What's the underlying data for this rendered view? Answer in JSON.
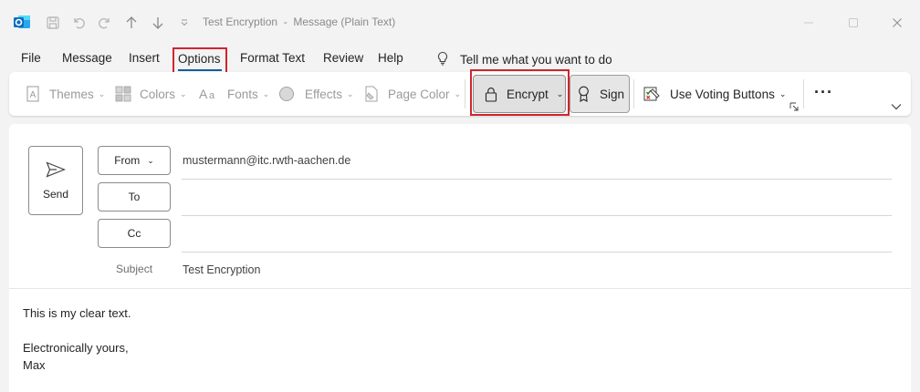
{
  "window": {
    "title": "Test Encryption",
    "title_sep": "-",
    "title_suffix": "Message (Plain Text)"
  },
  "menu": {
    "tabs": [
      "File",
      "Message",
      "Insert",
      "Options",
      "Format Text",
      "Review",
      "Help"
    ],
    "tell_me": "Tell me what you want to do"
  },
  "ribbon": {
    "themes": "Themes",
    "colors": "Colors",
    "fonts": "Fonts",
    "effects": "Effects",
    "page_color": "Page Color",
    "encrypt": "Encrypt",
    "sign": "Sign",
    "voting": "Use Voting Buttons",
    "more": "···"
  },
  "compose": {
    "send": "Send",
    "from_label": "From",
    "to_label": "To",
    "cc_label": "Cc",
    "from_value": "mustermann@itc.rwth-aachen.de",
    "subject_label": "Subject",
    "subject_value": "Test Encryption",
    "body": [
      "This is my clear text.",
      "",
      "Electronically yours,",
      "Max"
    ]
  },
  "colors": {
    "accent": "#115ea3",
    "highlight": "#d1252c",
    "outlook_blue": "#0f6cbd"
  }
}
